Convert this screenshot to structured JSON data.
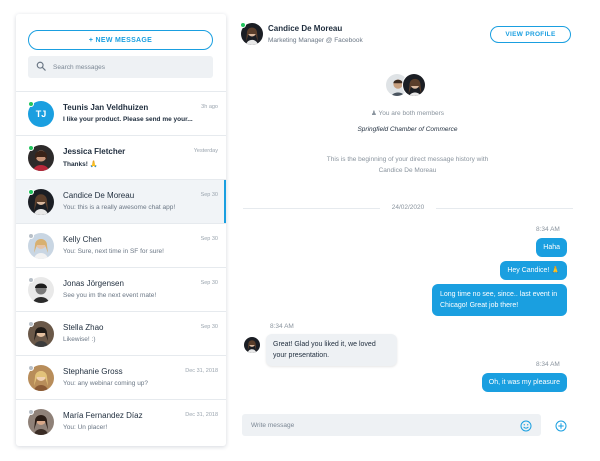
{
  "sidebar": {
    "new_message_label": "+ NEW MESSAGE",
    "search_placeholder": "Search messages",
    "conversations": [
      {
        "name": "Teunis Jan Veldhuizen",
        "time": "3h ago",
        "preview": "I like your product. Please send me your...",
        "initials": "TJ",
        "status": "online",
        "unread": true
      },
      {
        "name": "Jessica Fletcher",
        "time": "Yesterday",
        "preview": "Thanks! 🙏",
        "status": "online",
        "unread": true
      },
      {
        "name": "Candice De Moreau",
        "time": "Sep 30",
        "preview": "You: this is a really awesome chat app!",
        "status": "online",
        "active": true
      },
      {
        "name": "Kelly Chen",
        "time": "Sep 30",
        "preview": "You: Sure, next time in SF for sure!",
        "status": "offline"
      },
      {
        "name": "Jonas Jörgensen",
        "time": "Sep 30",
        "preview": "See you im the next event mate!",
        "status": "offline"
      },
      {
        "name": "Stella Zhao",
        "time": "Sep 30",
        "preview": "Likewise! :)",
        "status": "offline"
      },
      {
        "name": "Stephanie Gross",
        "time": "Dec 31, 2018",
        "preview": "You: any webinar coming up?",
        "status": "offline"
      },
      {
        "name": "María Fernandez Díaz",
        "time": "Dec 31, 2018",
        "preview": "You: Un placer!",
        "status": "offline"
      }
    ]
  },
  "chat": {
    "contact_name": "Candice De Moreau",
    "contact_title": "Marketing Manager @ Facebook",
    "view_profile_label": "VIEW PROFILE",
    "both_members": "You are both members",
    "group_name": "Springfield Chamber of Commerce",
    "beginning_text": "This is the beginning of your direct message history with Candice De Moreau",
    "date_divider": "24/02/2020",
    "messages": [
      {
        "direction": "out",
        "time": "8:34 AM",
        "text": "Haha"
      },
      {
        "direction": "out",
        "text": "Hey Candice! 🙏"
      },
      {
        "direction": "out",
        "text": "Long time no see, since.. last event in Chicago! Great job there!"
      },
      {
        "direction": "in",
        "time": "8:34 AM",
        "text": "Great! Glad you liked it, we loved your presentation."
      },
      {
        "direction": "out",
        "time": "8:34 AM",
        "text": "Oh, it was my pleasure"
      }
    ],
    "compose_placeholder": "Write message"
  },
  "colors": {
    "accent": "#1a9fe0",
    "online": "#22c55e",
    "bubble_in": "#eef1f4"
  },
  "icons": [
    "search-icon",
    "emoji-icon",
    "add-icon",
    "people-icon"
  ]
}
